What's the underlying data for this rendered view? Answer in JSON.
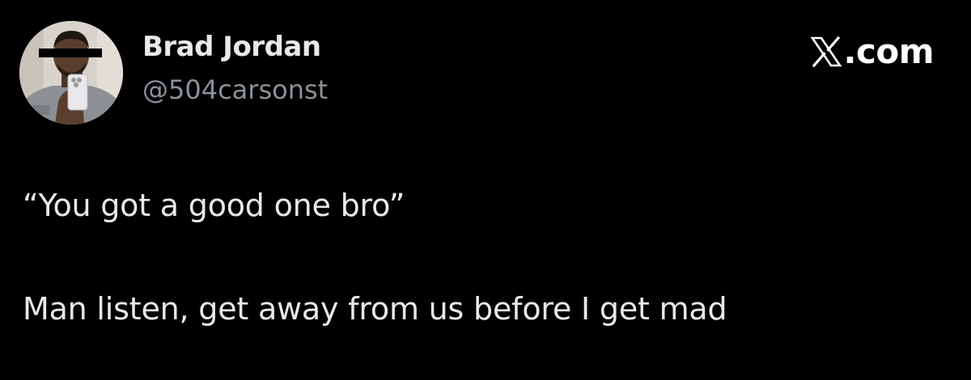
{
  "author": {
    "display_name": "Brad Jordan",
    "handle": "@504carsonst",
    "avatar_icon": "profile-photo-avatar"
  },
  "brand": {
    "text": ".com",
    "logo_icon": "x-logo-icon"
  },
  "tweet": {
    "lines": [
      "“You got a good one bro”",
      "Man listen, get away from us before I get mad"
    ]
  },
  "colors": {
    "background": "#000000",
    "primary_text": "#e7e9ea",
    "secondary_text": "#8b9197"
  }
}
